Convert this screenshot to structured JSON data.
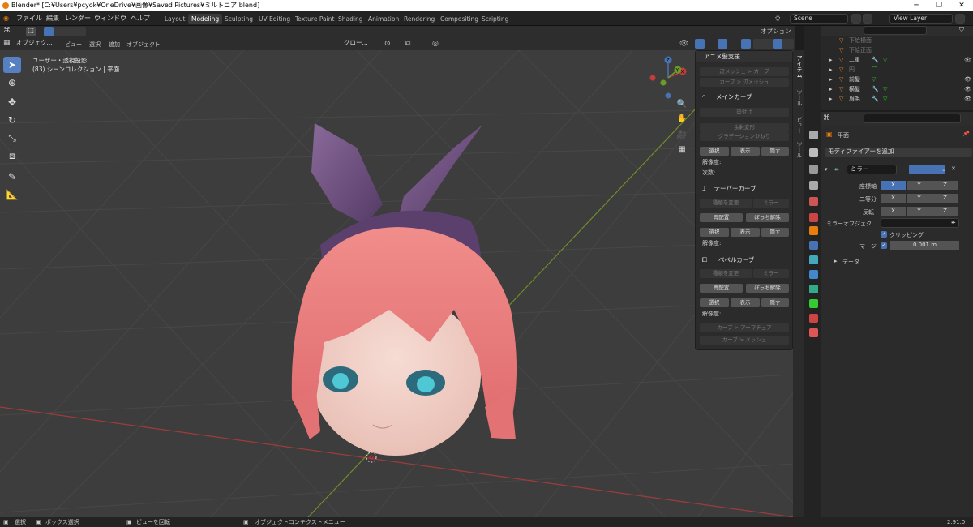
{
  "window": {
    "title": "Blender* [C:¥Users¥pcyok¥OneDrive¥画像¥Saved Pictures¥ミルトニア.blend]"
  },
  "menu": [
    "ファイル",
    "編集",
    "レンダー",
    "ウィンドウ",
    "ヘルプ"
  ],
  "workspaces": [
    "Layout",
    "Modeling",
    "Sculpting",
    "UV Editing",
    "Texture Paint",
    "Shading",
    "Animation",
    "Rendering",
    "Compositing",
    "Scripting"
  ],
  "active_workspace": "Modeling",
  "scene": "Scene",
  "view_layer": "View Layer",
  "viewport_header": {
    "mode": "オブジェク...",
    "menus": [
      "ビュー",
      "選択",
      "追加",
      "オブジェクト"
    ],
    "transform": "グロー...",
    "options": "オプション"
  },
  "viewport_overlay": {
    "view_name": "ユーザー・透視投影",
    "collection": "(83) シーンコレクション | 平面"
  },
  "gizmo": {
    "x": "X",
    "y": "Y",
    "z": "Z"
  },
  "npanel": {
    "title": "アニメ髪支援",
    "btn_mesh_to_curve": "辺メッシュ > カーブ",
    "btn_curve_to_mesh": "カーブ > 辺メッシュ",
    "main_curve": "メインカーブ",
    "btn_attach": "肉付け",
    "btn_random": "余剰変形",
    "btn_gradient": "グラデーションひねり",
    "select": "選択",
    "show": "表示",
    "hide": "隠す",
    "resolution": "解像度:",
    "order": "次数:",
    "taper_curve": "テーパーカーブ",
    "change_type": "種類を変更",
    "mirror": "ミラー",
    "reposition": "再配置",
    "unparent": "ぼっち解除",
    "bevel_curve": "ベベルカーブ",
    "btn_curve_to_armature": "カーブ > アーマチュア",
    "btn_curve_to_mesh2": "カーブ > メッシュ"
  },
  "side_tabs": [
    "アイテム",
    "ツール",
    "ビュー",
    "ツール"
  ],
  "outliner": [
    {
      "name": "下絵横面",
      "vis": false
    },
    {
      "name": "下絵正面",
      "vis": false
    },
    {
      "name": "二重",
      "vis": true
    },
    {
      "name": "円",
      "vis": false
    },
    {
      "name": "前髪",
      "vis": true
    },
    {
      "name": "横髪",
      "vis": true
    },
    {
      "name": "眉毛",
      "vis": true
    }
  ],
  "properties": {
    "object_name": "平面",
    "add_modifier": "モディファイアーを追加",
    "modifier_name": "ミラー",
    "axis_label": "座標軸",
    "bisect_label": "二等分",
    "flip_label": "反転",
    "axes": [
      "X",
      "Y",
      "Z"
    ],
    "mirror_object": "ミラーオブジェク...",
    "clipping": "クリッピング",
    "merge_label": "マージ",
    "merge_value": "0.001 m",
    "data": "データ"
  },
  "statusbar": {
    "select": "選択",
    "box_select": "ボックス選択",
    "rotate_view": "ビューを回転",
    "context_menu": "オブジェクトコンテクストメニュー",
    "version": "2.91.0"
  },
  "colors": {
    "accent": "#4772b3",
    "hair": "#e87a7a",
    "ribbon": "#6a4a7c",
    "grid_x": "#b54444",
    "grid_y": "#7a9b2a"
  }
}
